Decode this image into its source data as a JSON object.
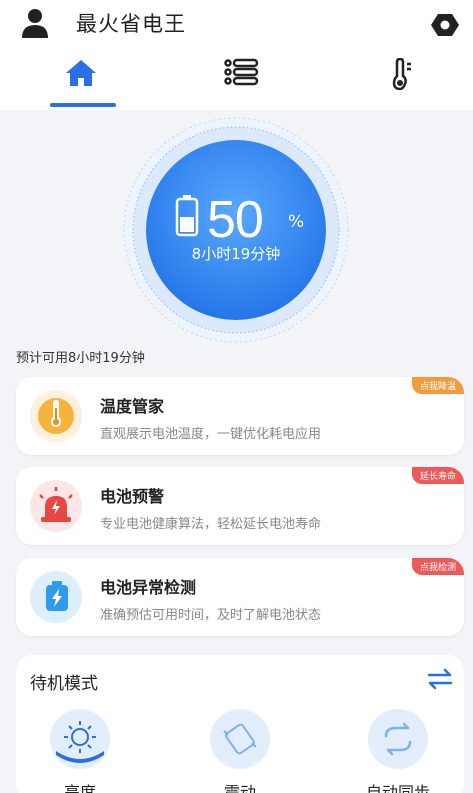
{
  "header": {
    "title": "最火省电王",
    "profile_icon": "user-icon",
    "settings_icon": "gear-icon"
  },
  "tabs": [
    {
      "name": "home",
      "icon": "home-icon",
      "active": true
    },
    {
      "name": "list",
      "icon": "list-icon",
      "active": false
    },
    {
      "name": "temperature",
      "icon": "thermometer-icon",
      "active": false
    }
  ],
  "battery": {
    "level": 50,
    "percent_value": "50",
    "percent_unit": "%",
    "remaining": "8小时19分钟"
  },
  "estimate": "预计可用8小时19分钟",
  "cards": [
    {
      "title": "温度管家",
      "desc": "直观展示电池温度，一键优化耗电应用",
      "badge": "点我降温",
      "badge_color": "#f59a3c",
      "icon": "thermometer-icon"
    },
    {
      "title": "电池预警",
      "desc": "专业电池健康算法，轻松延长电池寿命",
      "badge": "延长寿命",
      "badge_color": "#ec5a5a",
      "icon": "alarm-light-icon"
    },
    {
      "title": "电池异常检测",
      "desc": "准确预估可用时间，及时了解电池状态",
      "badge": "点我检测",
      "badge_color": "#ec5a5a",
      "icon": "battery-bolt-icon"
    }
  ],
  "standby": {
    "title": "待机模式",
    "modes": [
      {
        "label": "亮度",
        "icon": "brightness-icon",
        "active": true
      },
      {
        "label": "震动",
        "icon": "vibrate-icon",
        "active": false
      },
      {
        "label": "自动同步",
        "icon": "sync-icon",
        "active": false
      }
    ]
  },
  "colors": {
    "accent": "#2b6fe6",
    "hero_blue": "#3a8df0",
    "orange_badge": "#f59a3c",
    "red_badge": "#ec5a5a"
  }
}
